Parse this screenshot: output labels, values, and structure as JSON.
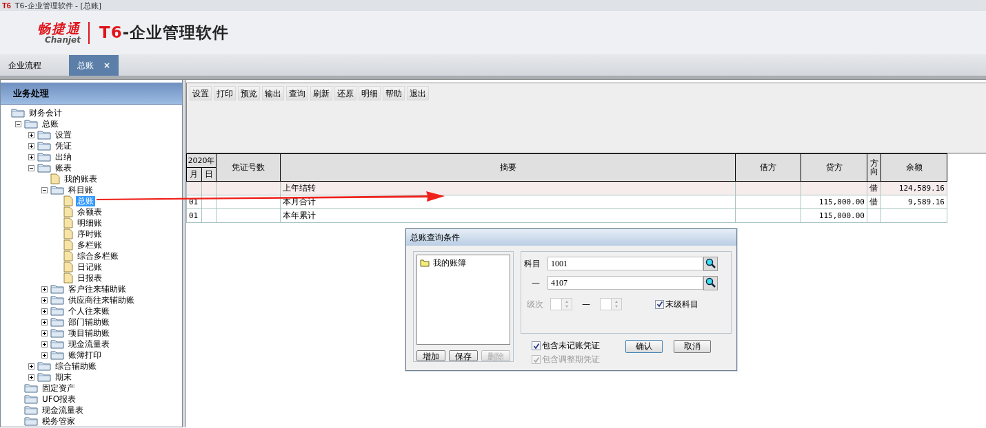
{
  "window": {
    "app_mark": "T6",
    "title": "T6-企业管理软件 - [总账]"
  },
  "brand": {
    "logo_cn": "畅捷通",
    "logo_en": "Chanjet",
    "product_mark": "T6",
    "product_name": "-企业管理软件"
  },
  "tabs": [
    {
      "label": "企业流程",
      "selected": false
    },
    {
      "label": "总账",
      "selected": true,
      "close": "×"
    }
  ],
  "sidebar": {
    "title": "业务处理",
    "tree": [
      {
        "label": "财务会计",
        "kind": "folder",
        "selected": false,
        "children": [
          {
            "label": "总账",
            "kind": "folder",
            "expanded": true,
            "selected": false,
            "children": [
              {
                "label": "设置",
                "kind": "folder",
                "expanded": false,
                "selected": false
              },
              {
                "label": "凭证",
                "kind": "folder",
                "expanded": false,
                "selected": false
              },
              {
                "label": "出纳",
                "kind": "folder",
                "expanded": false,
                "selected": false
              },
              {
                "label": "账表",
                "kind": "folder",
                "expanded": true,
                "selected": false,
                "children": [
                  {
                    "label": "我的账表",
                    "kind": "document",
                    "selected": false
                  },
                  {
                    "label": "科目账",
                    "kind": "folder",
                    "expanded": true,
                    "selected": false,
                    "children": [
                      {
                        "label": "总账",
                        "kind": "document",
                        "selected": true
                      },
                      {
                        "label": "余额表",
                        "kind": "document",
                        "selected": false
                      },
                      {
                        "label": "明细账",
                        "kind": "document",
                        "selected": false
                      },
                      {
                        "label": "序时账",
                        "kind": "document",
                        "selected": false
                      },
                      {
                        "label": "多栏账",
                        "kind": "document",
                        "selected": false
                      },
                      {
                        "label": "综合多栏账",
                        "kind": "document",
                        "selected": false
                      },
                      {
                        "label": "日记账",
                        "kind": "document",
                        "selected": false
                      },
                      {
                        "label": "日报表",
                        "kind": "document",
                        "selected": false
                      }
                    ]
                  },
                  {
                    "label": "客户往来辅助账",
                    "kind": "folder",
                    "expanded": false,
                    "selected": false
                  },
                  {
                    "label": "供应商往来辅助账",
                    "kind": "folder",
                    "expanded": false,
                    "selected": false
                  },
                  {
                    "label": "个人往来账",
                    "kind": "folder",
                    "expanded": false,
                    "selected": false
                  },
                  {
                    "label": "部门辅助账",
                    "kind": "folder",
                    "expanded": false,
                    "selected": false
                  },
                  {
                    "label": "项目辅助账",
                    "kind": "folder",
                    "expanded": false,
                    "selected": false
                  },
                  {
                    "label": "现金流量表",
                    "kind": "folder",
                    "expanded": false,
                    "selected": false
                  },
                  {
                    "label": "账簿打印",
                    "kind": "folder",
                    "expanded": false,
                    "selected": false
                  }
                ]
              },
              {
                "label": "综合辅助账",
                "kind": "folder",
                "expanded": false,
                "selected": false
              },
              {
                "label": "期末",
                "kind": "folder",
                "expanded": false,
                "selected": false
              }
            ]
          },
          {
            "label": "固定资产",
            "kind": "folder",
            "selected": false
          },
          {
            "label": "UFO报表",
            "kind": "folder",
            "selected": false
          },
          {
            "label": "现金流量表",
            "kind": "folder",
            "selected": false
          },
          {
            "label": "税务管家",
            "kind": "folder",
            "selected": false
          }
        ]
      }
    ]
  },
  "toolbar": [
    "设置",
    "打印",
    "预览",
    "输出",
    "查询",
    "刷新",
    "还原",
    "明细",
    "帮助",
    "退出"
  ],
  "table": {
    "year": "2020年",
    "month": "月",
    "day": "日",
    "columns": [
      "凭证号数",
      "摘要",
      "借方",
      "贷方",
      "方向",
      "余额"
    ],
    "rows": [
      {
        "month": "",
        "day": "",
        "voucher": "",
        "summary": "上年结转",
        "debit": "",
        "credit": "",
        "direction": "借",
        "balance": "124,589.16",
        "highlighted": true
      },
      {
        "month": "01",
        "day": "",
        "voucher": "",
        "summary": "本月合计",
        "debit": "",
        "credit": "115,000.00",
        "direction": "借",
        "balance": "9,589.16",
        "highlighted": false
      },
      {
        "month": "01",
        "day": "",
        "voucher": "",
        "summary": "本年累计",
        "debit": "",
        "credit": "115,000.00",
        "direction": "",
        "balance": "",
        "highlighted": false
      }
    ]
  },
  "dialog": {
    "title": "总账查询条件",
    "list": [
      "我的账簿"
    ],
    "list_buttons": [
      {
        "label": "增加",
        "disabled": false
      },
      {
        "label": "保存",
        "disabled": false
      },
      {
        "label": "删除",
        "disabled": true
      }
    ],
    "subject_label": "科目",
    "subject_from": "1001",
    "dash": "—",
    "subject_to": "4107",
    "level_label": "级次",
    "level_dash": "—",
    "leaf_only": {
      "label": "末级科目",
      "checked": true
    },
    "options": [
      {
        "label": "包含未记账凭证",
        "checked": true,
        "disabled": false
      },
      {
        "label": "包含调整期凭证",
        "checked": true,
        "disabled": true
      }
    ],
    "buttons": [
      "确认",
      "取消"
    ]
  }
}
